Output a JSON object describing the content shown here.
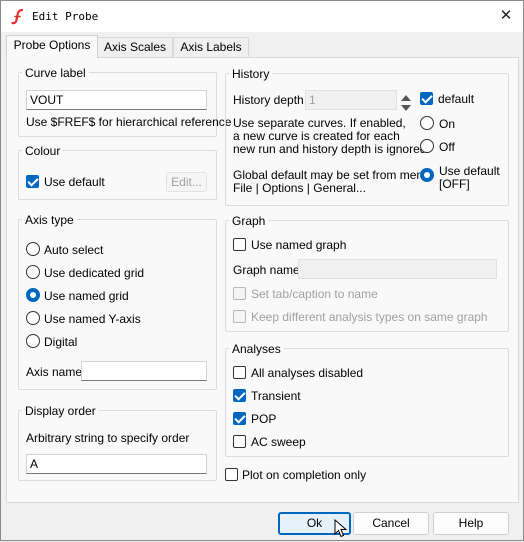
{
  "window": {
    "title": "Edit Probe",
    "close_glyph": "✕"
  },
  "tabs": [
    {
      "label": "Probe Options",
      "active": true
    },
    {
      "label": "Axis Scales",
      "active": false
    },
    {
      "label": "Axis Labels",
      "active": false
    }
  ],
  "curve_label": {
    "legend": "Curve label",
    "value": "VOUT",
    "hint": "Use $FREF$ for hierarchical reference"
  },
  "colour": {
    "legend": "Colour",
    "use_default_label": "Use default",
    "use_default_checked": true,
    "edit_button": "Edit..."
  },
  "axis_type": {
    "legend": "Axis type",
    "options": [
      {
        "label": "Auto select",
        "selected": false
      },
      {
        "label": "Use dedicated grid",
        "selected": false
      },
      {
        "label": "Use named grid",
        "selected": true
      },
      {
        "label": "Use named Y-axis",
        "selected": false
      },
      {
        "label": "Digital",
        "selected": false
      }
    ],
    "axis_name_label": "Axis name",
    "axis_name_value": ""
  },
  "display_order": {
    "legend": "Display order",
    "description": "Arbitrary string to specify order",
    "value": "A"
  },
  "history": {
    "legend": "History",
    "depth_label": "History depth",
    "depth_value": "1",
    "default_label": "default",
    "default_checked": true,
    "note_line1": "Use separate curves. If enabled,",
    "note_line2": "a new curve is created for each",
    "note_line3": "new run and history depth is ignored.",
    "on_label": "On",
    "off_label": "Off",
    "global_line1": "Global default may be set from menu",
    "global_line2": "File | Options | General...",
    "use_default_line1": "Use default",
    "use_default_line2": "[OFF]",
    "selected": "use_default"
  },
  "graph": {
    "legend": "Graph",
    "use_named_graph_label": "Use named graph",
    "use_named_graph_checked": false,
    "graph_name_label": "Graph name",
    "graph_name_value": "",
    "set_tab_label": "Set tab/caption to name",
    "keep_different_label": "Keep different analysis types on same graph"
  },
  "analyses": {
    "legend": "Analyses",
    "items": [
      {
        "label": "All analyses disabled",
        "checked": false
      },
      {
        "label": "Transient",
        "checked": true
      },
      {
        "label": "POP",
        "checked": true
      },
      {
        "label": "AC sweep",
        "checked": false
      }
    ]
  },
  "plot_on_completion": {
    "label": "Plot on completion only",
    "checked": false
  },
  "buttons": {
    "ok": "Ok",
    "cancel": "Cancel",
    "help": "Help"
  },
  "colors": {
    "accent": "#0067c0",
    "logo": "#e03030"
  }
}
